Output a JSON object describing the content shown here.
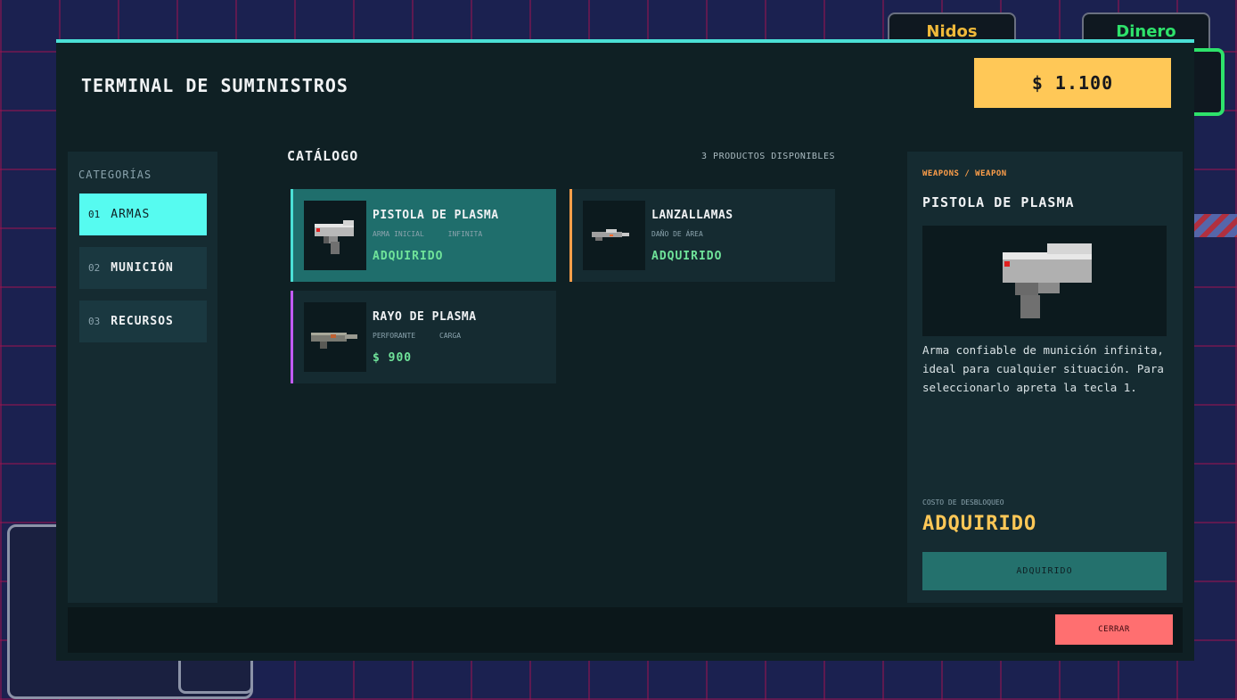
{
  "background_hud": {
    "tabs": [
      "Nidos",
      "Dinero"
    ]
  },
  "modal": {
    "title": "TERMINAL DE SUMINISTROS",
    "money": "$ 1.100",
    "accent_color": "#4be0d6"
  },
  "categories": {
    "heading": "CATEGORÍAS",
    "items": [
      {
        "num": "01",
        "label": "ARMAS",
        "active": true
      },
      {
        "num": "02",
        "label": "MUNICIÓN",
        "active": false
      },
      {
        "num": "03",
        "label": "RECURSOS",
        "active": false
      }
    ]
  },
  "catalog": {
    "title": "CATÁLOGO",
    "count": "3 PRODUCTOS DISPONIBLES",
    "products": [
      {
        "name": "PISTOLA DE PLASMA",
        "tags": [
          "ARMA INICIAL",
          "INFINITA"
        ],
        "price": "ADQUIRIDO",
        "border_color": "#4be0d6",
        "selected": true,
        "icon": "plasma-pistol-icon"
      },
      {
        "name": "LANZALLAMAS",
        "tags": [
          "DAÑO DE ÁREA"
        ],
        "price": "ADQUIRIDO",
        "border_color": "#ff9f4a",
        "selected": false,
        "icon": "flamethrower-icon"
      },
      {
        "name": "RAYO DE PLASMA",
        "tags": [
          "PERFORANTE",
          "CARGA"
        ],
        "price": "$ 900",
        "border_color": "#c25bff",
        "selected": false,
        "icon": "plasma-ray-icon"
      }
    ]
  },
  "detail": {
    "breadcrumb": "WEAPONS / WEAPON",
    "name": "PISTOLA DE PLASMA",
    "description": "Arma confiable de munición infinita, ideal para cualquier situación. Para seleccionarlo apreta la tecla 1.",
    "cost_label": "COSTO DE DESBLOQUEO",
    "cost_value": "ADQUIRIDO",
    "action_label": "ADQUIRIDO",
    "icon": "plasma-pistol-icon"
  },
  "footer": {
    "close_label": "CERRAR"
  }
}
